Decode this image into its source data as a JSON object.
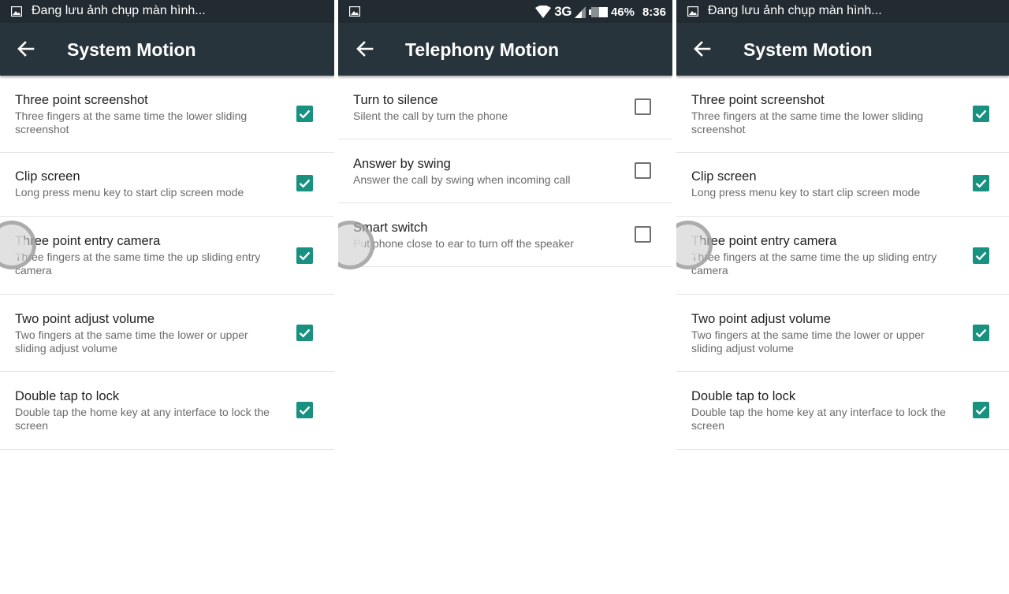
{
  "screens": [
    {
      "status": {
        "notification": "Đang lưu ảnh chụp màn hình..."
      },
      "toolbar": {
        "title": "System Motion",
        "back_icon": "arrow-left-icon"
      },
      "items": [
        {
          "title": "Three point screenshot",
          "summary": "Three fingers at the same time the lower sliding screenshot",
          "checked": true
        },
        {
          "title": "Clip screen",
          "summary": "Long press menu key to start clip screen mode",
          "checked": true
        },
        {
          "title": "Three point entry camera",
          "summary": "Three fingers at the same time the up sliding entry camera",
          "checked": true
        },
        {
          "title": "Two point adjust volume",
          "summary": "Two fingers at the same time the lower or upper sliding adjust volume",
          "checked": true
        },
        {
          "title": "Double tap to lock",
          "summary": "Double tap the home key at any interface to lock the screen",
          "checked": true
        }
      ]
    },
    {
      "status": {
        "network": "3G",
        "battery": "46%",
        "time": "8:36"
      },
      "toolbar": {
        "title": "Telephony Motion",
        "back_icon": "arrow-left-icon"
      },
      "items": [
        {
          "title": "Turn to silence",
          "summary": "Silent the call by turn the phone",
          "checked": false
        },
        {
          "title": "Answer by swing",
          "summary": "Answer the call by swing when incoming call",
          "checked": false
        },
        {
          "title": "Smart switch",
          "summary": "Put phone close to ear to turn off the speaker",
          "checked": false
        }
      ]
    },
    {
      "status": {
        "notification": "Đang lưu ảnh chụp màn hình..."
      },
      "toolbar": {
        "title": "System Motion",
        "back_icon": "arrow-left-icon"
      },
      "items": [
        {
          "title": "Three point screenshot",
          "summary": "Three fingers at the same time the lower sliding screenshot",
          "checked": true
        },
        {
          "title": "Clip screen",
          "summary": "Long press menu key to start clip screen mode",
          "checked": true
        },
        {
          "title": "Three point entry camera",
          "summary": "Three fingers at the same time the up sliding entry camera",
          "checked": true
        },
        {
          "title": "Two point adjust volume",
          "summary": "Two fingers at the same time the lower or upper sliding adjust volume",
          "checked": true
        },
        {
          "title": "Double tap to lock",
          "summary": "Double tap the home key at any interface to lock the screen",
          "checked": true
        }
      ]
    }
  ],
  "colors": {
    "statusbar": "#222b31",
    "toolbar": "#27343b",
    "accent": "#199181"
  }
}
